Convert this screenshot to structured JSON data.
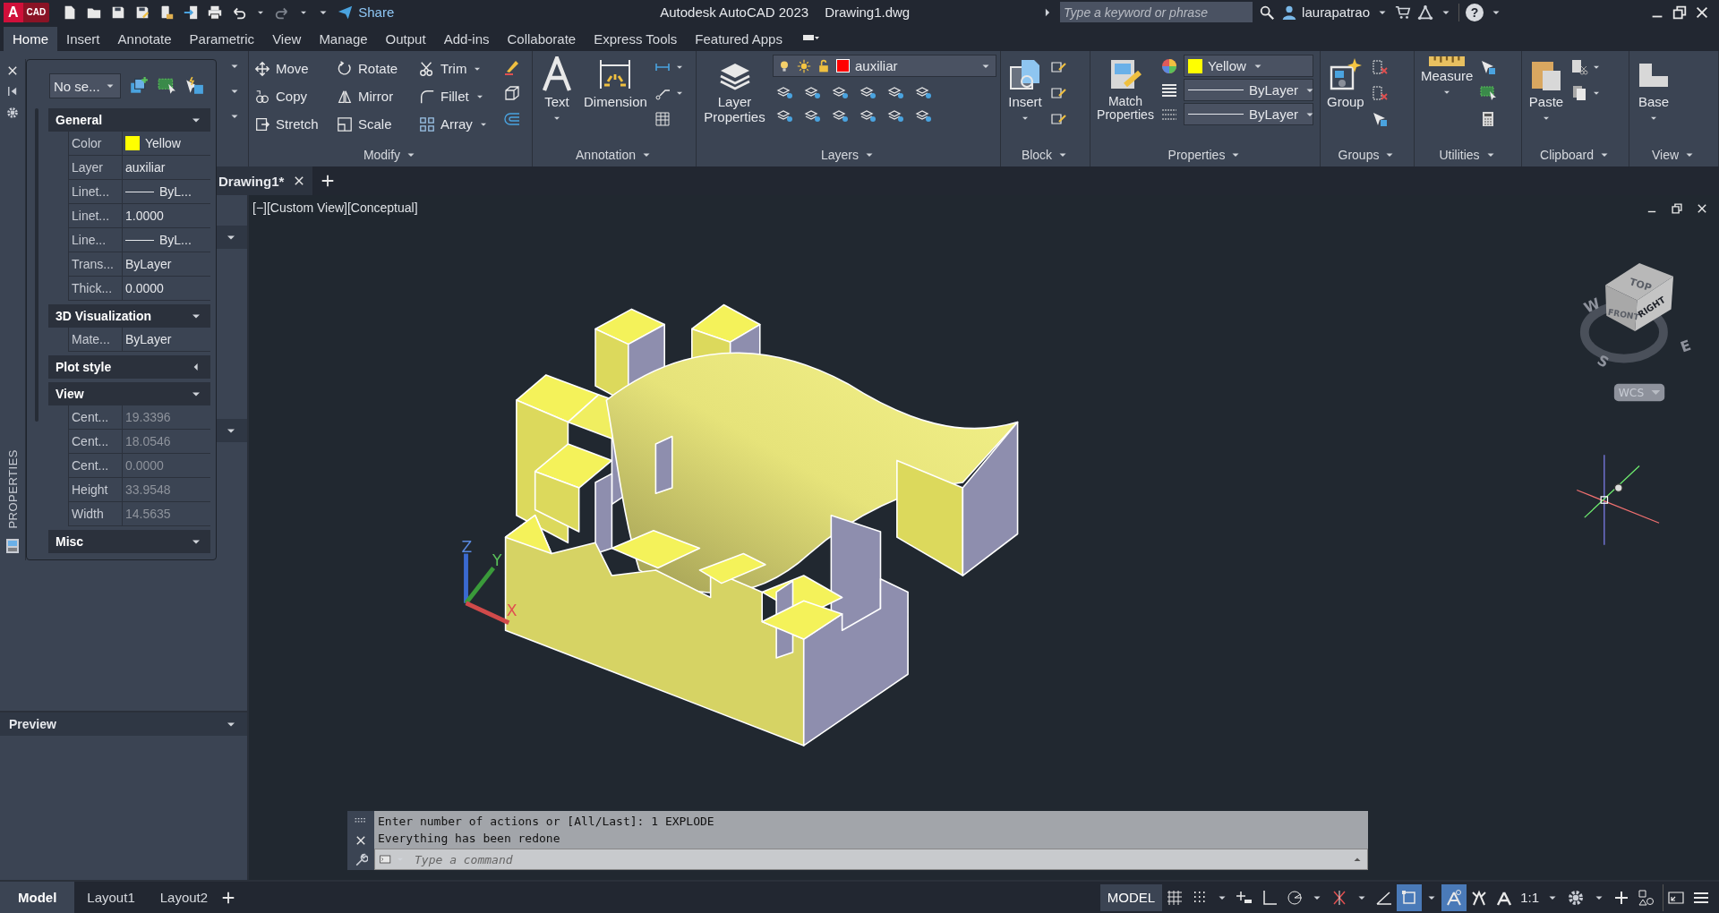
{
  "logo": {
    "letter": "A",
    "badge": "CAD"
  },
  "quick_access": {
    "share": "Share"
  },
  "title": {
    "app": "Autodesk AutoCAD 2023",
    "file": "Drawing1.dwg"
  },
  "search": {
    "placeholder": "Type a keyword or phrase"
  },
  "user": {
    "name": "laurapatrao"
  },
  "help": "?",
  "ribbon_tabs": [
    {
      "label": "Home",
      "selected": true
    },
    {
      "label": "Insert",
      "selected": false
    },
    {
      "label": "Annotate",
      "selected": false
    },
    {
      "label": "Parametric",
      "selected": false
    },
    {
      "label": "View",
      "selected": false
    },
    {
      "label": "Manage",
      "selected": false
    },
    {
      "label": "Output",
      "selected": false
    },
    {
      "label": "Add-ins",
      "selected": false
    },
    {
      "label": "Collaborate",
      "selected": false
    },
    {
      "label": "Express Tools",
      "selected": false
    },
    {
      "label": "Featured Apps",
      "selected": false
    }
  ],
  "ribbon_panels": [
    {
      "kind": "draw"
    },
    {
      "kind": "modify",
      "title": "Modify",
      "tools": [
        "Move",
        "Rotate",
        "Trim",
        "Copy",
        "Mirror",
        "Fillet",
        "Stretch",
        "Scale",
        "Array"
      ]
    },
    {
      "kind": "annotation",
      "title": "Annotation",
      "tools": [
        "Text",
        "Dimension"
      ]
    },
    {
      "kind": "layers",
      "title": "Layers",
      "tools": [
        "Layer Properties"
      ],
      "current_layer": "auxiliar"
    },
    {
      "kind": "block",
      "title": "Block",
      "tools": [
        "Insert"
      ]
    },
    {
      "kind": "properties",
      "title": "Properties",
      "tools": [
        "Match Properties"
      ],
      "color_name": "Yellow",
      "linetype": "ByLayer",
      "lineweight": "ByLayer"
    },
    {
      "kind": "groups",
      "title": "Groups",
      "tools": [
        "Group"
      ]
    },
    {
      "kind": "utilities",
      "title": "Utilities",
      "tools": [
        "Measure"
      ]
    },
    {
      "kind": "clipboard",
      "title": "Clipboard",
      "tools": [
        "Paste"
      ]
    },
    {
      "kind": "view",
      "title": "View",
      "tools": [
        "Base"
      ]
    }
  ],
  "document_tabs": [
    {
      "label": "Drawing1*",
      "selected": true
    }
  ],
  "viewport": {
    "label": "[−][Custom View][Conceptual]"
  },
  "viewcube": {
    "top": "TOP",
    "front": "FRONT",
    "right": "RIGHT",
    "west": "W",
    "south": "S",
    "east": "E",
    "coordinate_system": "WCS"
  },
  "ucs": {
    "x": "X",
    "y": "Y",
    "z": "Z"
  },
  "properties_palette": {
    "title": "PROPERTIES",
    "selection": "No se...",
    "sections": [
      {
        "title": "General",
        "expanded": true,
        "rows": [
          {
            "label": "Color",
            "value": "Yellow",
            "kind": "swatch",
            "readonly": false
          },
          {
            "label": "Layer",
            "value": "auxiliar",
            "kind": "text",
            "readonly": false
          },
          {
            "label": "Linet...",
            "value": "ByL...",
            "kind": "line",
            "readonly": false
          },
          {
            "label": "Linet...",
            "value": "1.0000",
            "kind": "text",
            "readonly": false
          },
          {
            "label": "Line...",
            "value": "ByL...",
            "kind": "line",
            "readonly": false
          },
          {
            "label": "Trans...",
            "value": "ByLayer",
            "kind": "text",
            "readonly": false
          },
          {
            "label": "Thick...",
            "value": "0.0000",
            "kind": "text",
            "readonly": false
          }
        ]
      },
      {
        "title": "3D Visualization",
        "expanded": true,
        "rows": [
          {
            "label": "Mate...",
            "value": "ByLayer",
            "kind": "text",
            "readonly": false
          }
        ]
      },
      {
        "title": "Plot style",
        "expanded": false
      },
      {
        "title": "View",
        "expanded": true,
        "rows": [
          {
            "label": "Cent...",
            "value": "19.3396",
            "kind": "text",
            "readonly": true
          },
          {
            "label": "Cent...",
            "value": "18.0546",
            "kind": "text",
            "readonly": true
          },
          {
            "label": "Cent...",
            "value": "0.0000",
            "kind": "text",
            "readonly": true
          },
          {
            "label": "Height",
            "value": "33.9548",
            "kind": "text",
            "readonly": true
          },
          {
            "label": "Width",
            "value": "14.5635",
            "kind": "text",
            "readonly": true
          }
        ]
      },
      {
        "title": "Misc",
        "expanded": true
      }
    ]
  },
  "preview_panel": {
    "title": "Preview"
  },
  "command_line": {
    "history": [
      "Enter number of actions or [All/Last]: 1 EXPLODE",
      "Everything has been redone"
    ],
    "placeholder": "Type a command"
  },
  "layout_tabs": [
    {
      "label": "Model",
      "selected": true
    },
    {
      "label": "Layout1",
      "selected": false
    },
    {
      "label": "Layout2",
      "selected": false
    }
  ],
  "status_bar": {
    "space": "MODEL",
    "scale": "1:1"
  }
}
